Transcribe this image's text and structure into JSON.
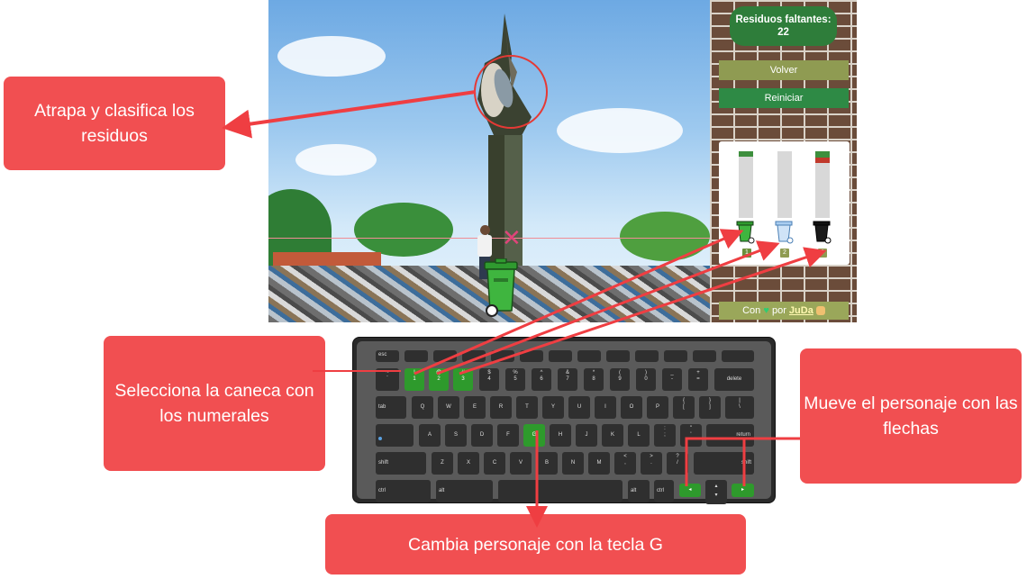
{
  "game": {
    "remaining_label": "Residuos faltantes:",
    "remaining_count": "22",
    "back_button": "Volver",
    "restart_button": "Reiniciar",
    "bins": [
      {
        "key": "1",
        "color": "#2e7d32",
        "fill_fraction": 0.08
      },
      {
        "key": "2",
        "color": "#7fb3e0",
        "fill_fraction": 0.0
      },
      {
        "key": "3",
        "color": "#111111",
        "fill_fraction": 0.16
      }
    ],
    "credits_prefix": "Con",
    "credits_by": "por",
    "credits_author": "JuDa",
    "heart_icon": "green-heart-icon",
    "hand_icon": "waving-hand-icon"
  },
  "callouts": {
    "catch": "Atrapa y clasifica los residuos",
    "select_bin": "Selecciona la caneca con los numerales",
    "move": "Mueve el personaje con las flechas",
    "change_character": "Cambia personaje con la tecla G"
  },
  "keyboard": {
    "esc": "esc",
    "row1": [
      [
        "~",
        "`"
      ],
      [
        "!",
        "1"
      ],
      [
        "@",
        "2"
      ],
      [
        "#",
        "3"
      ],
      [
        "$",
        "4"
      ],
      [
        "%",
        "5"
      ],
      [
        "^",
        "6"
      ],
      [
        "&",
        "7"
      ],
      [
        "*",
        "8"
      ],
      [
        "(",
        "9"
      ],
      [
        ")",
        "0"
      ],
      [
        "_",
        "-"
      ],
      [
        "+",
        "="
      ]
    ],
    "delete": "delete",
    "tab": "tab",
    "row2": [
      "Q",
      "W",
      "E",
      "R",
      "T",
      "Y",
      "U",
      "I",
      "O",
      "P"
    ],
    "row2_extra": [
      [
        "{",
        "["
      ],
      [
        "}",
        "]"
      ],
      [
        "|",
        "\\"
      ]
    ],
    "row3": [
      "A",
      "S",
      "D",
      "F",
      "G",
      "H",
      "J",
      "K",
      "L"
    ],
    "row3_extra": [
      [
        ":",
        ";"
      ],
      [
        "\"",
        "'"
      ]
    ],
    "return": "return",
    "shift": "shift",
    "row4": [
      "Z",
      "X",
      "C",
      "V",
      "B",
      "N",
      "M"
    ],
    "row4_extra": [
      [
        "<",
        ","
      ],
      [
        ">",
        "."
      ],
      [
        "?",
        "/"
      ]
    ],
    "ctrl": "ctrl",
    "alt": "alt",
    "arrow_left": "◂",
    "arrow_right": "▸",
    "arrow_up": "▴",
    "arrow_down": "▾",
    "highlighted_keys": [
      "1",
      "2",
      "3",
      "G",
      "left",
      "right"
    ],
    "highlight_color": "#2e9a2c"
  }
}
